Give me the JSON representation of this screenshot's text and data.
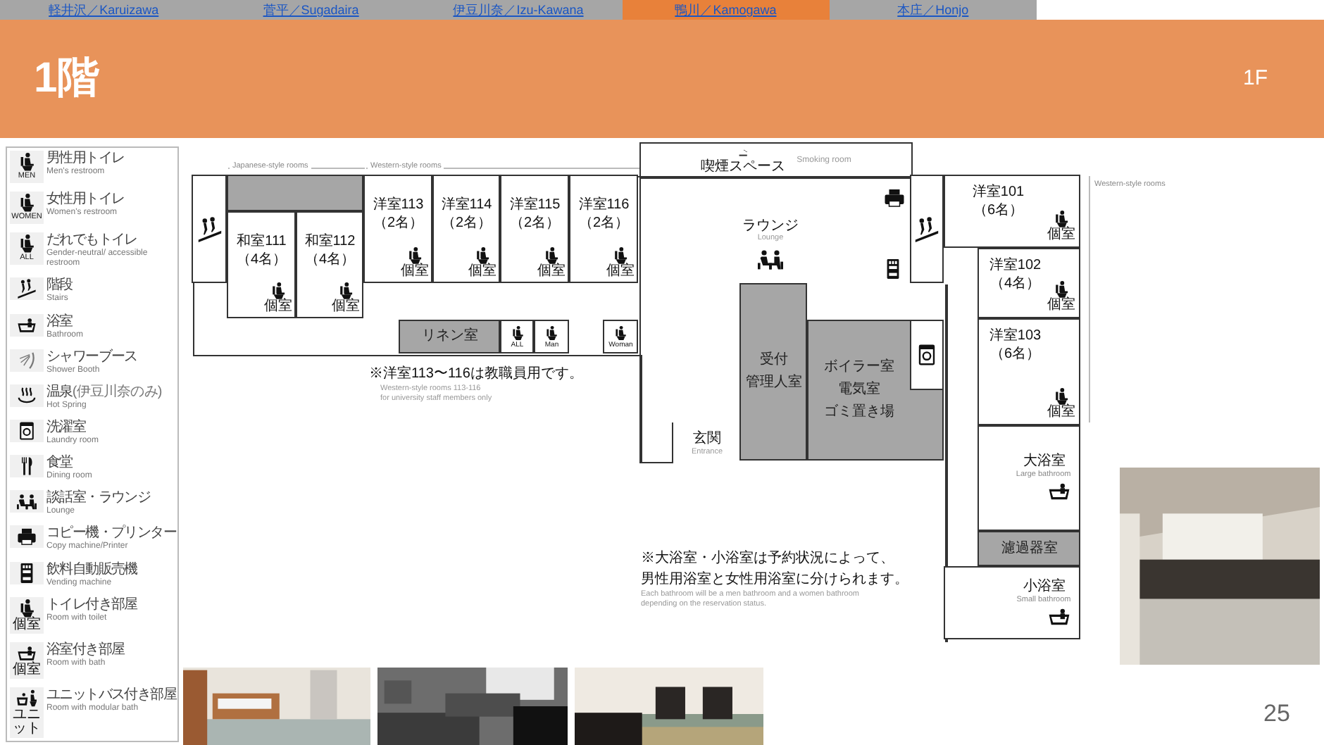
{
  "tabs": [
    {
      "label": "軽井沢／Karuizawa",
      "selected": false
    },
    {
      "label": "菅平／Sugadaira",
      "selected": false
    },
    {
      "label": "伊豆川奈／Izu-Kawana",
      "selected": false
    },
    {
      "label": "鴨川／Kamogawa",
      "selected": true
    },
    {
      "label": "本庄／Honjo",
      "selected": false
    }
  ],
  "title": "1階",
  "floor": "1F",
  "legend": [
    {
      "kind": "toilet",
      "badge": "MEN",
      "ja": "男性用トイレ",
      "en": "Men's restroom"
    },
    {
      "kind": "toilet",
      "badge": "WOMEN",
      "ja": "女性用トイレ",
      "en": "Women's restroom"
    },
    {
      "kind": "toilet",
      "badge": "ALL",
      "ja": "だれでもトイレ",
      "en": "Gender-neutral/ accessible restroom"
    },
    {
      "kind": "stairs",
      "ja": "階段",
      "en": "Stairs"
    },
    {
      "kind": "bath",
      "ja": "浴室",
      "en": "Bathroom"
    },
    {
      "kind": "shower",
      "ja": "シャワーブース",
      "en": "Shower Booth"
    },
    {
      "kind": "hotspring",
      "ja": "温泉",
      "note": "(伊豆川奈のみ)",
      "en": "Hot Spring"
    },
    {
      "kind": "laundry",
      "ja": "洗濯室",
      "en": "Laundry room"
    },
    {
      "kind": "dining",
      "ja": "食堂",
      "en": "Dining room"
    },
    {
      "kind": "lounge",
      "ja": "談話室・ラウンジ",
      "en": "Lounge"
    },
    {
      "kind": "printer",
      "ja": "コピー機・プリンター",
      "en": "Copy machine/Printer"
    },
    {
      "kind": "vending",
      "ja": "飲料自動販売機",
      "en": "Vending machine"
    },
    {
      "kind": "toilet",
      "badge": "個室",
      "ja": "トイレ付き部屋",
      "en": "Room with toilet"
    },
    {
      "kind": "bath",
      "badge": "個室",
      "ja": "浴室付き部屋",
      "en": "Room with bath"
    },
    {
      "kind": "unitbath",
      "badge": "ユニット",
      "ja": "ユニットバス付き部屋",
      "en": "Room with modular bath"
    }
  ],
  "plan": {
    "section_labels": [
      "Japanese-style rooms",
      "Western-style rooms",
      "Western-style rooms"
    ],
    "smoking": {
      "name": "喫煙スペース",
      "en": "Smoking room"
    },
    "lounge": {
      "name": "ラウンジ",
      "en": "Lounge"
    },
    "entrance": {
      "name": "玄関",
      "en": "Entrance"
    },
    "rooms": [
      {
        "kind": "stairs"
      },
      {
        "kind": "service"
      },
      {
        "kind": "room",
        "name": "和室111",
        "capacity": "（4名）",
        "badge": "個室"
      },
      {
        "kind": "room",
        "name": "和室112",
        "capacity": "（4名）",
        "badge": "個室"
      },
      {
        "kind": "room",
        "name": "洋室113",
        "capacity": "（2名）",
        "badge": "個室"
      },
      {
        "kind": "room",
        "name": "洋室114",
        "capacity": "（2名）",
        "badge": "個室"
      },
      {
        "kind": "room",
        "name": "洋室115",
        "capacity": "（2名）",
        "badge": "個室"
      },
      {
        "kind": "room",
        "name": "洋室116",
        "capacity": "（2名）",
        "badge": "個室"
      },
      {
        "kind": "service",
        "lines": [
          "リネン室"
        ]
      },
      {
        "kind": "toilet",
        "badge": "ALL"
      },
      {
        "kind": "toilet",
        "badge": "Man"
      },
      {
        "kind": "toilet",
        "badge": "Woman"
      },
      {
        "kind": "stairs"
      },
      {
        "kind": "service",
        "lines": [
          "受付",
          "管理人室"
        ]
      },
      {
        "kind": "service",
        "lines": [
          "ボイラー室",
          "電気室",
          "ゴミ置き場"
        ]
      },
      {
        "kind": "laundry"
      },
      {
        "kind": "room",
        "name": "洋室101",
        "capacity": "（6名）",
        "badge": "個室"
      },
      {
        "kind": "room",
        "name": "洋室102",
        "capacity": "（4名）",
        "badge": "個室"
      },
      {
        "kind": "room",
        "name": "洋室103",
        "capacity": "（6名）",
        "badge": "個室"
      },
      {
        "kind": "bath",
        "name": "大浴室",
        "en": "Large bathroom"
      },
      {
        "kind": "service",
        "lines": [
          "濾過器室"
        ]
      },
      {
        "kind": "bath",
        "name": "小浴室",
        "en": "Small bathroom"
      }
    ],
    "notes": [
      {
        "lines": [
          "※洋室113〜116は教職員用です。"
        ],
        "en": [
          "Western-style rooms 113-116",
          "for university staff members only"
        ]
      },
      {
        "lines": [
          "※大浴室・小浴室は予約状況によって、",
          "男性用浴室と女性用浴室に分けられます。"
        ],
        "en": [
          "Each bathroom will be a men bathroom and a women bathroom",
          "depending on the reservation status."
        ]
      }
    ]
  },
  "page_number": "25"
}
